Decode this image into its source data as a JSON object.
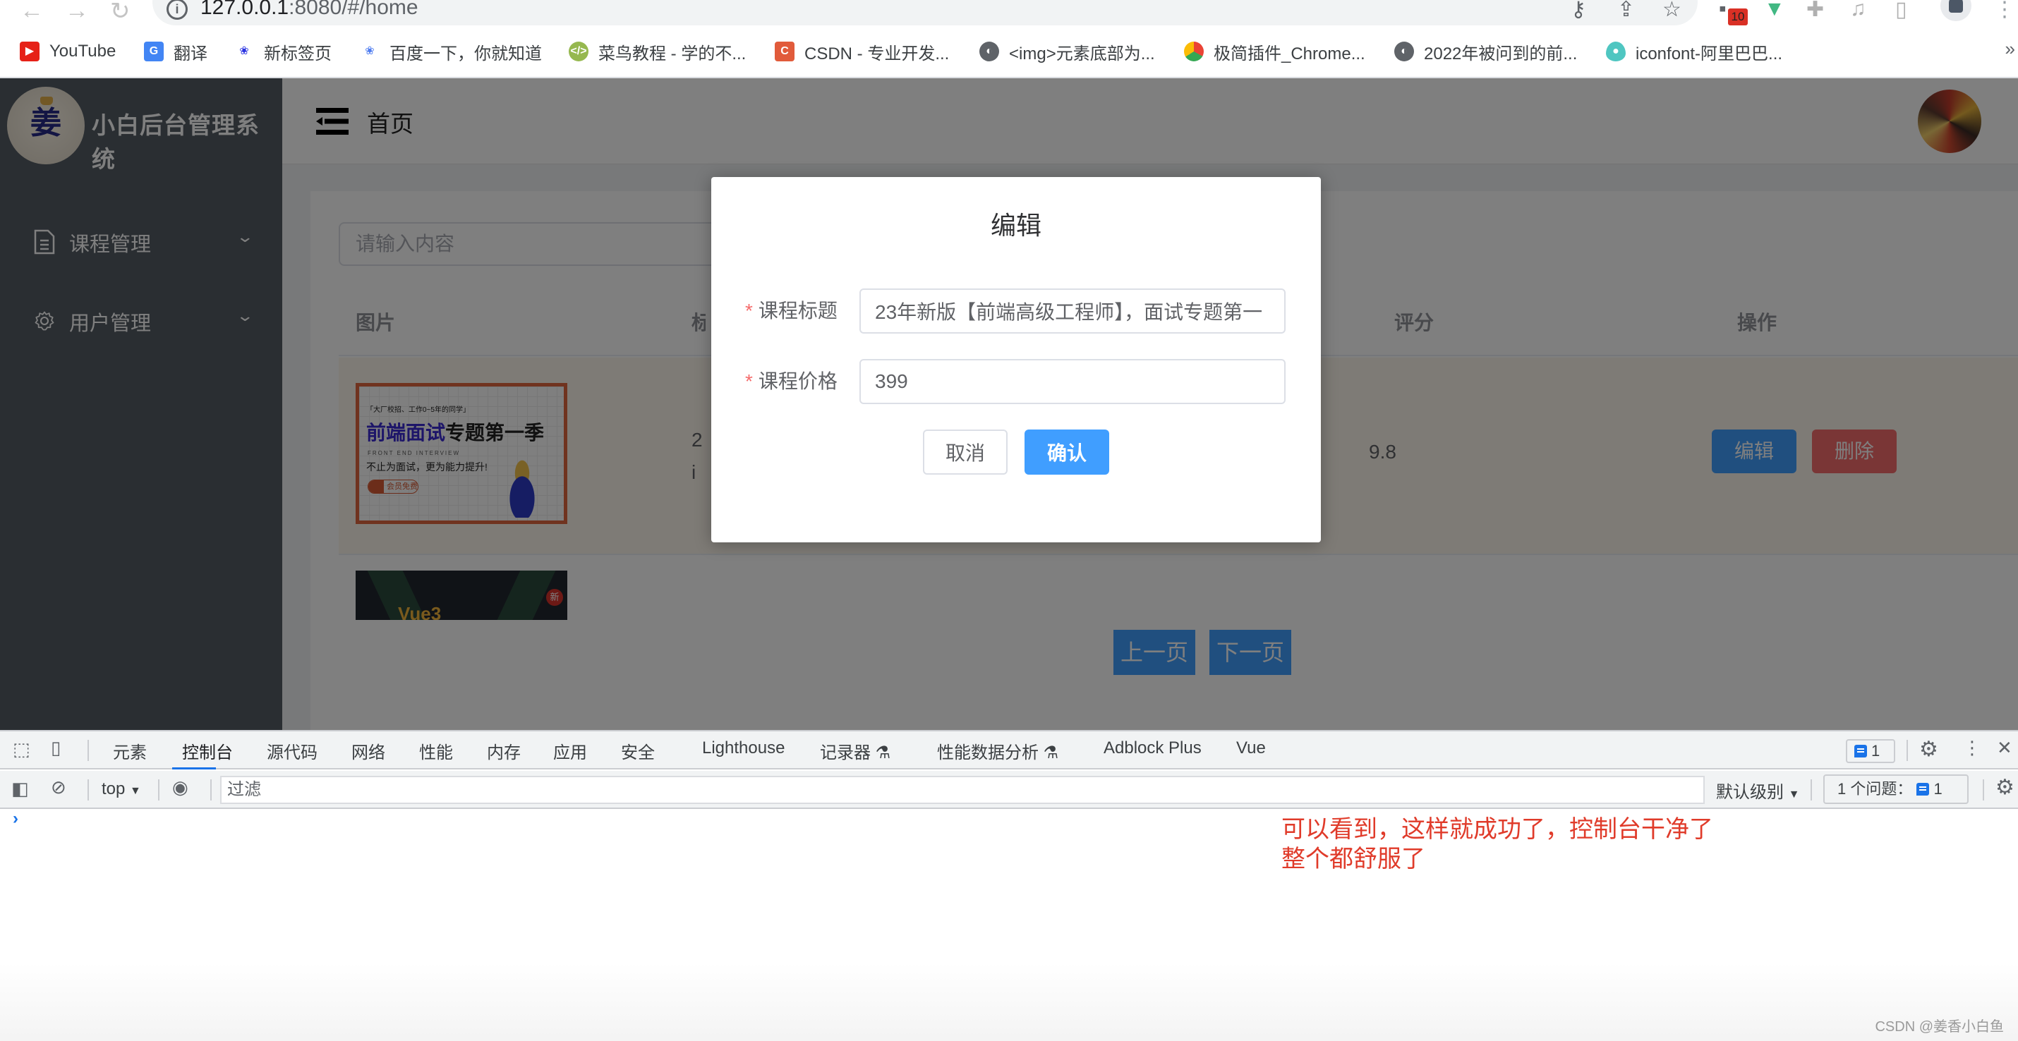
{
  "browser": {
    "url_host": "127.0.0.1",
    "url_rest": ":8080/#/home",
    "extension_badge": "10",
    "bookmarks": [
      {
        "label": "YouTube",
        "icon": "youtube-icon",
        "color": "#e62117"
      },
      {
        "label": "翻译",
        "icon": "google-translate-icon",
        "color": "#4285f4"
      },
      {
        "label": "新标签页",
        "icon": "baidu-icon",
        "color": "#2932e1"
      },
      {
        "label": "百度一下，你就知道",
        "icon": "baidu-icon",
        "color": "#2932e1"
      },
      {
        "label": "菜鸟教程 - 学的不...",
        "icon": "runoob-icon",
        "color": "#96b84f"
      },
      {
        "label": "CSDN - 专业开发...",
        "icon": "csdn-icon",
        "color": "#e15b3b"
      },
      {
        "label": "<img>元素底部为...",
        "icon": "globe-icon",
        "color": "#5f6368"
      },
      {
        "label": "极简插件_Chrome...",
        "icon": "chrome-store-icon",
        "color": "#e94335"
      },
      {
        "label": "2022年被问到的前...",
        "icon": "globe-icon",
        "color": "#5f6368"
      },
      {
        "label": "iconfont-阿里巴巴...",
        "icon": "iconfont-icon",
        "color": "#4fc6c1"
      }
    ],
    "more_bookmarks": "»"
  },
  "app": {
    "title": "小白后台管理系统",
    "sidebar": {
      "items": [
        {
          "label": "课程管理",
          "icon": "document-icon"
        },
        {
          "label": "用户管理",
          "icon": "gear-icon"
        }
      ]
    },
    "header": {
      "breadcrumb": "首页"
    },
    "search": {
      "placeholder": "请输入内容",
      "value": ""
    },
    "table": {
      "columns": [
        "图片",
        "标题",
        "评分",
        "操作"
      ],
      "rows": [
        {
          "image_caption_small": "「大厂校招、工作0~5年的同学」",
          "image_caption_big_a": "前端面试",
          "image_caption_big_b": "专题第一季",
          "image_caption_en": "FRONT END INTERVIEW",
          "image_slogan": "不止为面试，更为能力提升!",
          "image_badge": "会员免费",
          "title_visible_line1": "2",
          "title_visible_line2": "i",
          "rating": "9.8",
          "edit_label": "编辑",
          "delete_label": "删除"
        },
        {
          "image_badge": "新",
          "image_caption": "Vue3"
        }
      ]
    },
    "pagination": {
      "prev_label": "上一页",
      "next_label": "下一页"
    }
  },
  "dialog": {
    "title": "编辑",
    "fields": [
      {
        "label": "课程标题",
        "required": "*",
        "value": "23年新版【前端高级工程师】，面试专题第一"
      },
      {
        "label": "课程价格",
        "required": "*",
        "value": "399"
      }
    ],
    "cancel_label": "取消",
    "confirm_label": "确认"
  },
  "devtools": {
    "tabs": [
      "元素",
      "控制台",
      "源代码",
      "网络",
      "性能",
      "内存",
      "应用",
      "安全",
      "Lighthouse",
      "记录器",
      "性能数据分析",
      "Adblock Plus",
      "Vue"
    ],
    "active_tab": "控制台",
    "issues_badge": "1",
    "context": "top",
    "filter_placeholder": "过滤",
    "level": "默认级别",
    "issues_label": "1 个问题：",
    "issues_count": "1",
    "prompt": "›"
  },
  "annotation": {
    "line1": "可以看到，这样就成功了，控制台干净了",
    "line2": "整个都舒服了",
    "color": "#e03b2a"
  },
  "watermark": "CSDN @姜香小白鱼"
}
